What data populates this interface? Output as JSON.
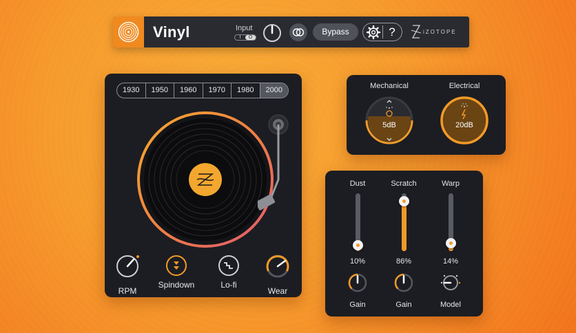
{
  "header": {
    "title": "Vinyl",
    "input_label": "Input",
    "input_toggle_off": "I",
    "input_toggle_on": "O",
    "bypass_label": "Bypass",
    "help_label": "?",
    "brand": "iZOTOPE"
  },
  "turntable": {
    "years": [
      "1930",
      "1950",
      "1960",
      "1970",
      "1980",
      "2000"
    ],
    "selected_year": "2000",
    "controls": {
      "rpm_label": "RPM",
      "spindown_label": "Spindown",
      "lofi_label": "Lo-fi",
      "wear_label": "Wear"
    }
  },
  "noise": {
    "mechanical_label": "Mechanical",
    "mechanical_value": "5dB",
    "electrical_label": "Electrical",
    "electrical_value": "20dB"
  },
  "mixer": {
    "dust_label": "Dust",
    "dust_value": "10%",
    "dust_level": 0.1,
    "scratch_label": "Scratch",
    "scratch_value": "86%",
    "scratch_level": 0.86,
    "warp_label": "Warp",
    "warp_value": "14%",
    "warp_level": 0.14,
    "dust_gain_label": "Gain",
    "scratch_gain_label": "Gain",
    "model_label": "Model"
  },
  "colors": {
    "accent": "#f29a28",
    "panel": "#1c1d22",
    "topbar": "#2a2b31"
  }
}
